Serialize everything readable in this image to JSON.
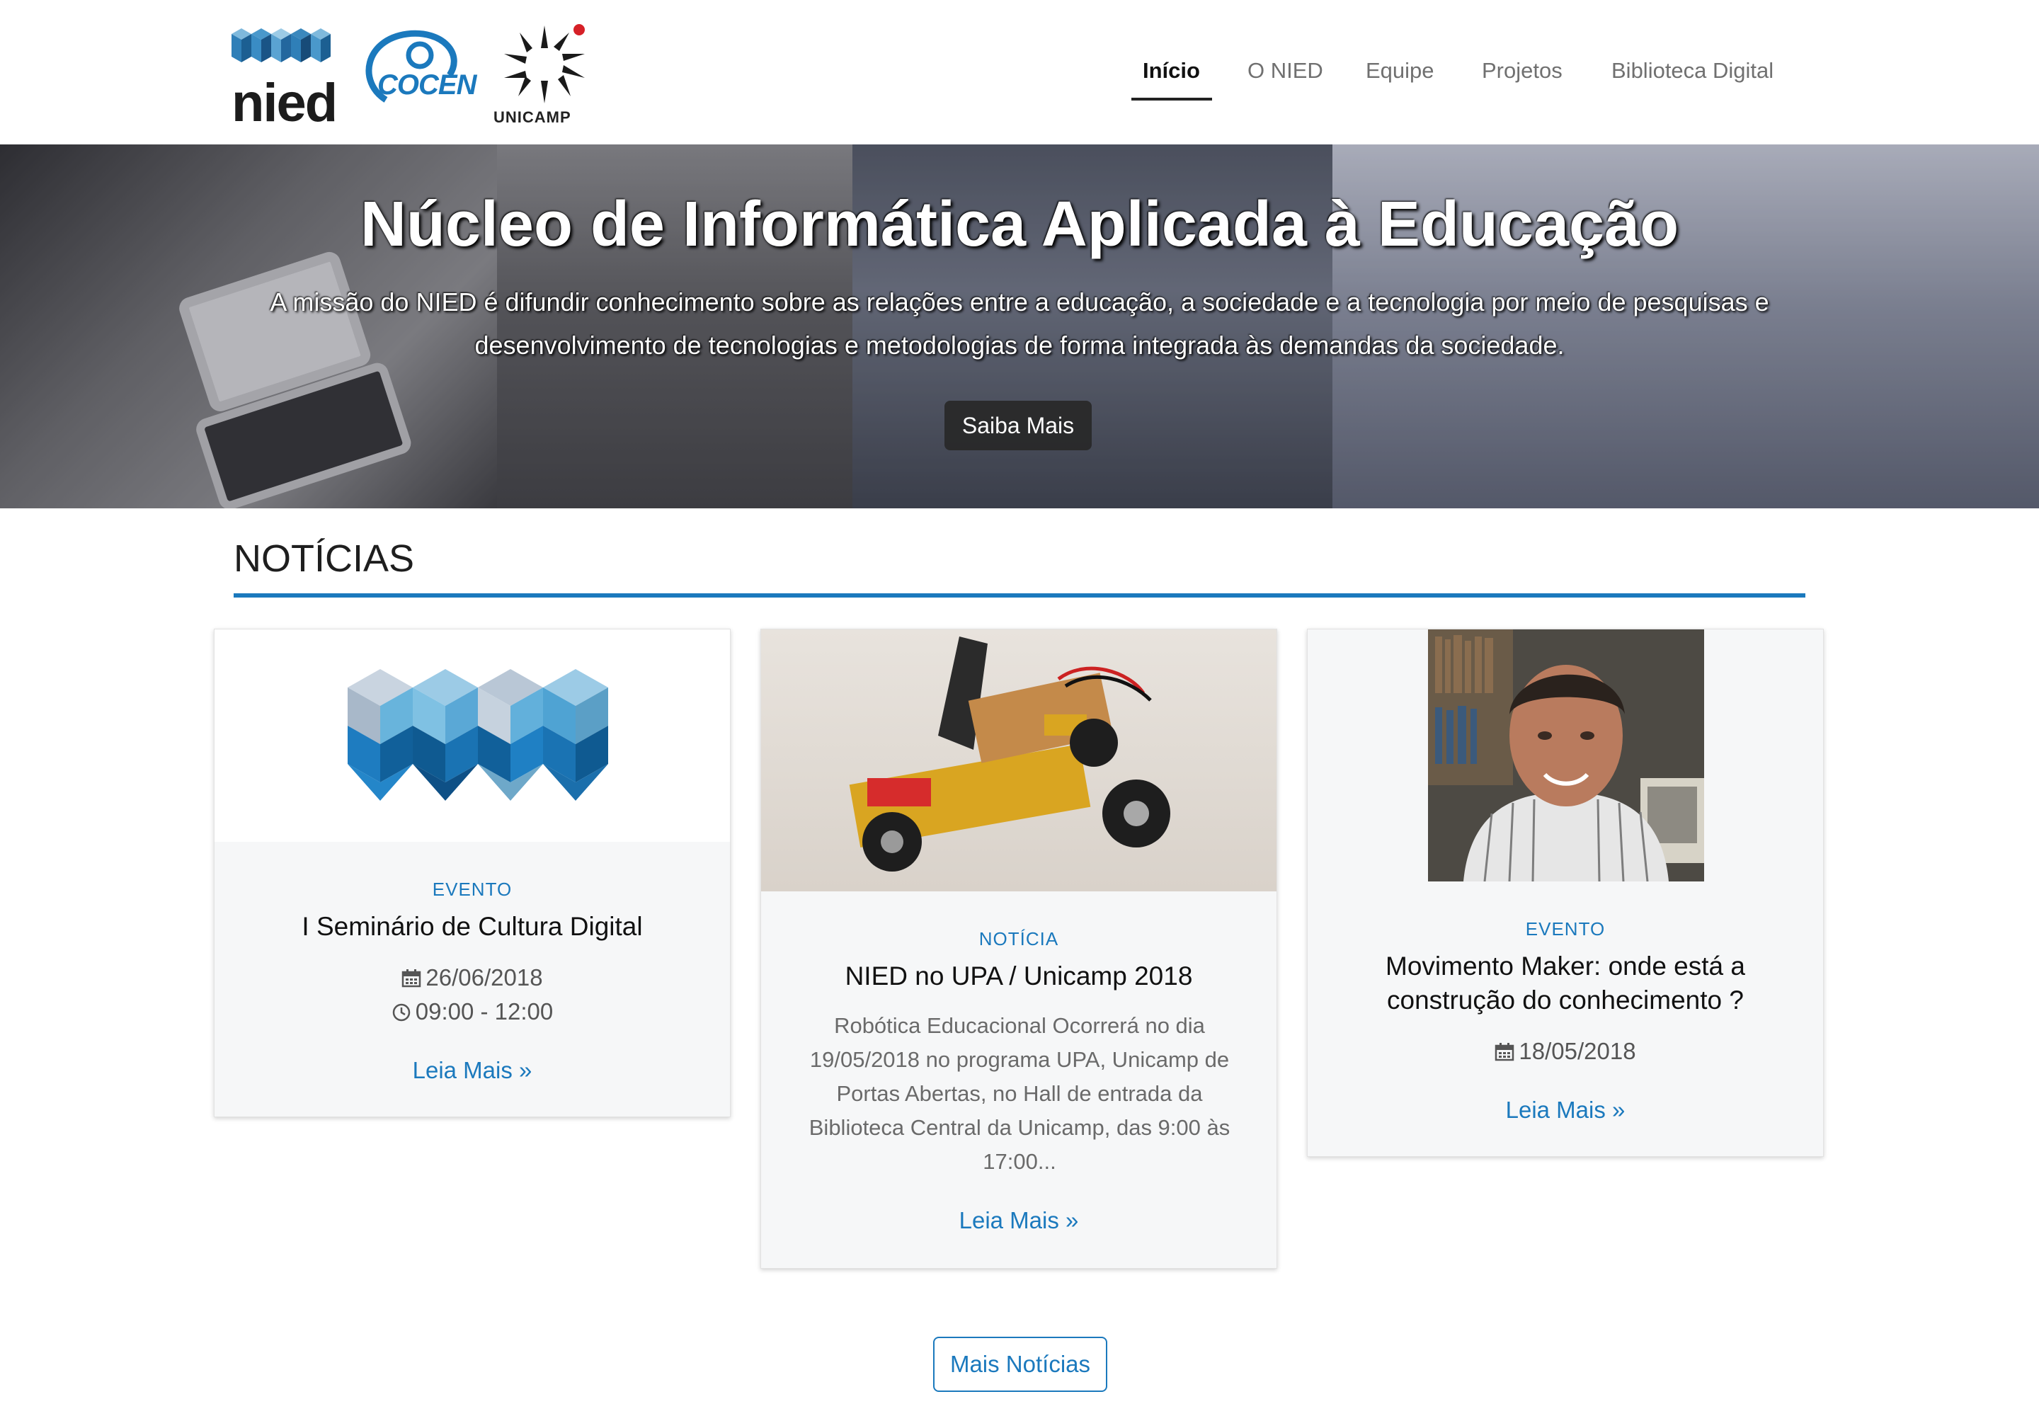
{
  "header": {
    "logos": {
      "nied": "nied",
      "cocen": "COCEN",
      "unicamp": "UNICAMP"
    },
    "nav": [
      {
        "label": "Início",
        "active": true
      },
      {
        "label": "O NIED",
        "active": false
      },
      {
        "label": "Equipe",
        "active": false
      },
      {
        "label": "Projetos",
        "active": false
      },
      {
        "label": "Biblioteca Digital",
        "active": false
      }
    ]
  },
  "hero": {
    "title": "Núcleo de Informática Aplicada à Educação",
    "subtitle_line1": "A missão do NIED é difundir conhecimento sobre as relações entre a educação, a sociedade e a tecnologia por meio de pesquisas e",
    "subtitle_line2": "desenvolvimento de tecnologias e metodologias de forma integrada às demandas da sociedade.",
    "button": "Saiba Mais"
  },
  "news": {
    "heading": "NOTÍCIAS",
    "cards": [
      {
        "category": "EVENTO",
        "title": "I Seminário de Cultura Digital",
        "date": "26/06/2018",
        "time": "09:00 - 12:00",
        "link": "Leia Mais »"
      },
      {
        "category": "NOTÍCIA",
        "title": "NIED no UPA / Unicamp 2018",
        "description": "Robótica Educacional Ocorrerá no dia 19/05/2018 no programa UPA, Unicamp de Portas Abertas, no Hall de entrada da Biblioteca Central da Unicamp, das 9:00 às 17:00...",
        "link": "Leia Mais »"
      },
      {
        "category": "EVENTO",
        "title_line1": "Movimento Maker: onde está a",
        "title_line2": "construção do conhecimento ?",
        "date": "18/05/2018",
        "link": "Leia Mais »"
      }
    ],
    "more_button": "Mais Notícias"
  },
  "colors": {
    "accent": "#1b79bd",
    "nav_active": "#111111",
    "nav_inactive": "#707070"
  },
  "icons": [
    "nied-logo",
    "cocen-logo",
    "unicamp-logo",
    "calendar-icon",
    "clock-icon"
  ]
}
